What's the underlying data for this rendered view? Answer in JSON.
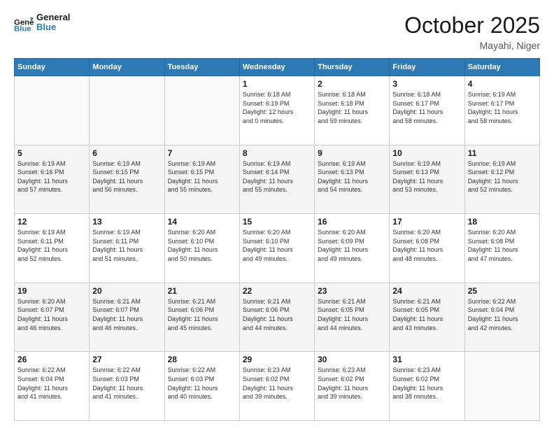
{
  "header": {
    "logo_general": "General",
    "logo_blue": "Blue",
    "month_title": "October 2025",
    "location": "Mayahi, Niger"
  },
  "weekdays": [
    "Sunday",
    "Monday",
    "Tuesday",
    "Wednesday",
    "Thursday",
    "Friday",
    "Saturday"
  ],
  "weeks": [
    [
      {
        "day": "",
        "info": ""
      },
      {
        "day": "",
        "info": ""
      },
      {
        "day": "",
        "info": ""
      },
      {
        "day": "1",
        "info": "Sunrise: 6:18 AM\nSunset: 6:19 PM\nDaylight: 12 hours\nand 0 minutes."
      },
      {
        "day": "2",
        "info": "Sunrise: 6:18 AM\nSunset: 6:18 PM\nDaylight: 11 hours\nand 59 minutes."
      },
      {
        "day": "3",
        "info": "Sunrise: 6:18 AM\nSunset: 6:17 PM\nDaylight: 11 hours\nand 58 minutes."
      },
      {
        "day": "4",
        "info": "Sunrise: 6:19 AM\nSunset: 6:17 PM\nDaylight: 11 hours\nand 58 minutes."
      }
    ],
    [
      {
        "day": "5",
        "info": "Sunrise: 6:19 AM\nSunset: 6:16 PM\nDaylight: 11 hours\nand 57 minutes."
      },
      {
        "day": "6",
        "info": "Sunrise: 6:19 AM\nSunset: 6:15 PM\nDaylight: 11 hours\nand 56 minutes."
      },
      {
        "day": "7",
        "info": "Sunrise: 6:19 AM\nSunset: 6:15 PM\nDaylight: 11 hours\nand 55 minutes."
      },
      {
        "day": "8",
        "info": "Sunrise: 6:19 AM\nSunset: 6:14 PM\nDaylight: 11 hours\nand 55 minutes."
      },
      {
        "day": "9",
        "info": "Sunrise: 6:19 AM\nSunset: 6:13 PM\nDaylight: 11 hours\nand 54 minutes."
      },
      {
        "day": "10",
        "info": "Sunrise: 6:19 AM\nSunset: 6:13 PM\nDaylight: 11 hours\nand 53 minutes."
      },
      {
        "day": "11",
        "info": "Sunrise: 6:19 AM\nSunset: 6:12 PM\nDaylight: 11 hours\nand 52 minutes."
      }
    ],
    [
      {
        "day": "12",
        "info": "Sunrise: 6:19 AM\nSunset: 6:11 PM\nDaylight: 11 hours\nand 52 minutes."
      },
      {
        "day": "13",
        "info": "Sunrise: 6:19 AM\nSunset: 6:11 PM\nDaylight: 11 hours\nand 51 minutes."
      },
      {
        "day": "14",
        "info": "Sunrise: 6:20 AM\nSunset: 6:10 PM\nDaylight: 11 hours\nand 50 minutes."
      },
      {
        "day": "15",
        "info": "Sunrise: 6:20 AM\nSunset: 6:10 PM\nDaylight: 11 hours\nand 49 minutes."
      },
      {
        "day": "16",
        "info": "Sunrise: 6:20 AM\nSunset: 6:09 PM\nDaylight: 11 hours\nand 49 minutes."
      },
      {
        "day": "17",
        "info": "Sunrise: 6:20 AM\nSunset: 6:08 PM\nDaylight: 11 hours\nand 48 minutes."
      },
      {
        "day": "18",
        "info": "Sunrise: 6:20 AM\nSunset: 6:08 PM\nDaylight: 11 hours\nand 47 minutes."
      }
    ],
    [
      {
        "day": "19",
        "info": "Sunrise: 6:20 AM\nSunset: 6:07 PM\nDaylight: 11 hours\nand 46 minutes."
      },
      {
        "day": "20",
        "info": "Sunrise: 6:21 AM\nSunset: 6:07 PM\nDaylight: 11 hours\nand 46 minutes."
      },
      {
        "day": "21",
        "info": "Sunrise: 6:21 AM\nSunset: 6:06 PM\nDaylight: 11 hours\nand 45 minutes."
      },
      {
        "day": "22",
        "info": "Sunrise: 6:21 AM\nSunset: 6:06 PM\nDaylight: 11 hours\nand 44 minutes."
      },
      {
        "day": "23",
        "info": "Sunrise: 6:21 AM\nSunset: 6:05 PM\nDaylight: 11 hours\nand 44 minutes."
      },
      {
        "day": "24",
        "info": "Sunrise: 6:21 AM\nSunset: 6:05 PM\nDaylight: 11 hours\nand 43 minutes."
      },
      {
        "day": "25",
        "info": "Sunrise: 6:22 AM\nSunset: 6:04 PM\nDaylight: 11 hours\nand 42 minutes."
      }
    ],
    [
      {
        "day": "26",
        "info": "Sunrise: 6:22 AM\nSunset: 6:04 PM\nDaylight: 11 hours\nand 41 minutes."
      },
      {
        "day": "27",
        "info": "Sunrise: 6:22 AM\nSunset: 6:03 PM\nDaylight: 11 hours\nand 41 minutes."
      },
      {
        "day": "28",
        "info": "Sunrise: 6:22 AM\nSunset: 6:03 PM\nDaylight: 11 hours\nand 40 minutes."
      },
      {
        "day": "29",
        "info": "Sunrise: 6:23 AM\nSunset: 6:02 PM\nDaylight: 11 hours\nand 39 minutes."
      },
      {
        "day": "30",
        "info": "Sunrise: 6:23 AM\nSunset: 6:02 PM\nDaylight: 11 hours\nand 39 minutes."
      },
      {
        "day": "31",
        "info": "Sunrise: 6:23 AM\nSunset: 6:02 PM\nDaylight: 11 hours\nand 38 minutes."
      },
      {
        "day": "",
        "info": ""
      }
    ]
  ]
}
